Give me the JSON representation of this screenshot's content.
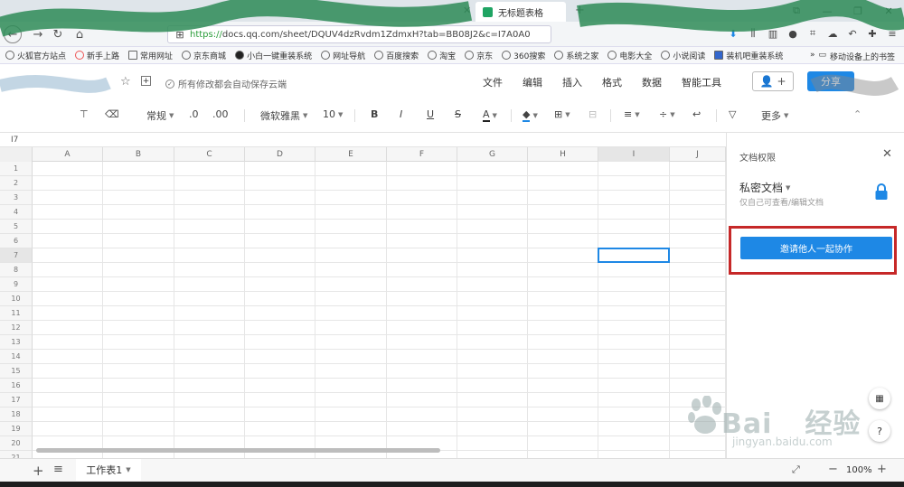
{
  "browser": {
    "tab_title": "无标题表格",
    "url_scheme": "https://",
    "url_rest": "docs.qq.com/sheet/DQUV4dzRvdm1ZdmxH?tab=BB08J2&c=I7A0A0",
    "bookmarks": [
      "火狐官方站点",
      "新手上路",
      "常用网址",
      "京东商城",
      "小白一键重装系统",
      "网址导航",
      "百度搜索",
      "淘宝",
      "京东",
      "360搜索",
      "系统之家",
      "电影大全",
      "小说阅读",
      "装机吧重装系统"
    ],
    "mobile_bookmarks": "移动设备上的书签"
  },
  "header": {
    "save_status": "所有修改都会自动保存云端",
    "menu": [
      "文件",
      "编辑",
      "插入",
      "格式",
      "数据",
      "智能工具"
    ],
    "share_label": "分享"
  },
  "toolbar": {
    "format_label": "常规",
    "decimal_dec": ".0",
    "decimal_inc": ".00",
    "font_family": "微软雅黑",
    "font_size": "10",
    "bold": "B",
    "italic": "I",
    "underline": "U",
    "strike": "S",
    "font_color_letter": "A",
    "more_label": "更多"
  },
  "sheet": {
    "cell_ref": "I7",
    "columns": [
      "A",
      "B",
      "C",
      "D",
      "E",
      "F",
      "G",
      "H",
      "I",
      "J"
    ],
    "rows": [
      "1",
      "2",
      "3",
      "4",
      "5",
      "6",
      "7",
      "8",
      "9",
      "10",
      "11",
      "12",
      "13",
      "14",
      "15",
      "16",
      "17",
      "18",
      "19",
      "20",
      "21"
    ],
    "selected_cell": "I7"
  },
  "bottom": {
    "sheet_tab": "工作表1",
    "zoom": "100%"
  },
  "panel": {
    "title": "文档权限",
    "privacy_label": "私密文档",
    "privacy_sub": "仅自己可查看/编辑文档",
    "invite_label": "邀请他人一起协作",
    "help_label": "?"
  },
  "watermark": {
    "brand": "Bai",
    "brand2": "经验",
    "sub": "jingyan.baidu.com"
  },
  "colors": {
    "accent": "#1e88e5",
    "highlight_frame": "#c62828",
    "favicon": "#1fa463"
  }
}
